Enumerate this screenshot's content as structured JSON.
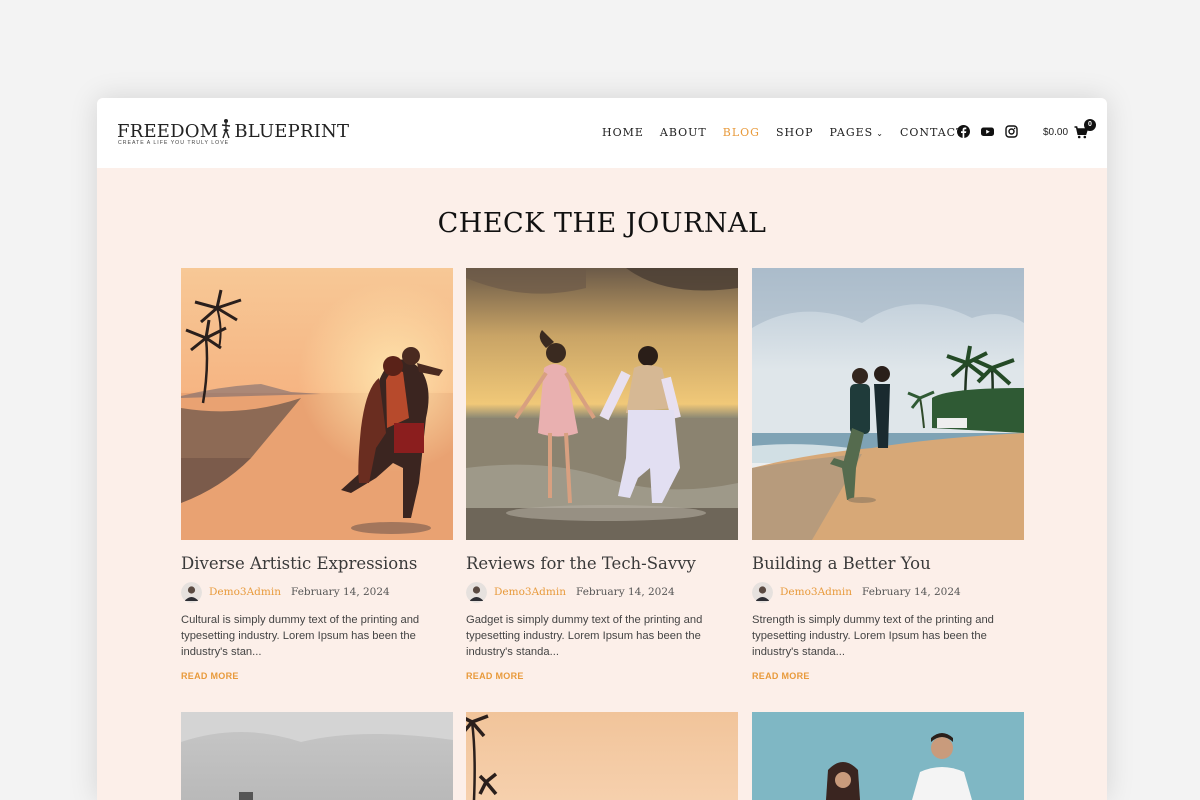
{
  "brand": {
    "logo_left": "FREEDOM",
    "logo_right": "BLUEPRINT",
    "tagline": "CREATE A LIFE YOU TRULY LOVE"
  },
  "nav": {
    "items": [
      "HOME",
      "ABOUT",
      "BLOG",
      "SHOP",
      "PAGES",
      "CONTACT"
    ],
    "active": "BLOG"
  },
  "social": [
    "facebook-icon",
    "youtube-icon",
    "instagram-icon"
  ],
  "cart": {
    "total": "$0.00",
    "count": "0"
  },
  "section": {
    "title": "CHECK THE JOURNAL"
  },
  "posts": [
    {
      "title": "Diverse Artistic Expressions",
      "author": "Demo3Admin",
      "date": "February 14, 2024",
      "excerpt": "Cultural  is simply dummy text of the printing and typesetting industry. Lorem Ipsum has been the industry's stan...",
      "read_more": "READ MORE"
    },
    {
      "title": "Reviews for the Tech-Savvy",
      "author": "Demo3Admin",
      "date": "February 14, 2024",
      "excerpt": "Gadget  is simply dummy text of the printing and typesetting industry. Lorem Ipsum has been the industry's standa...",
      "read_more": "READ MORE"
    },
    {
      "title": "Building a Better You",
      "author": "Demo3Admin",
      "date": "February 14, 2024",
      "excerpt": "Strength is simply dummy text of the printing and typesetting industry. Lorem Ipsum has been the industry's standa...",
      "read_more": "READ MORE"
    }
  ],
  "colors": {
    "accent": "#e89a3b",
    "page_bg": "#fcefe9",
    "outer_bg": "#f3f3f3"
  }
}
